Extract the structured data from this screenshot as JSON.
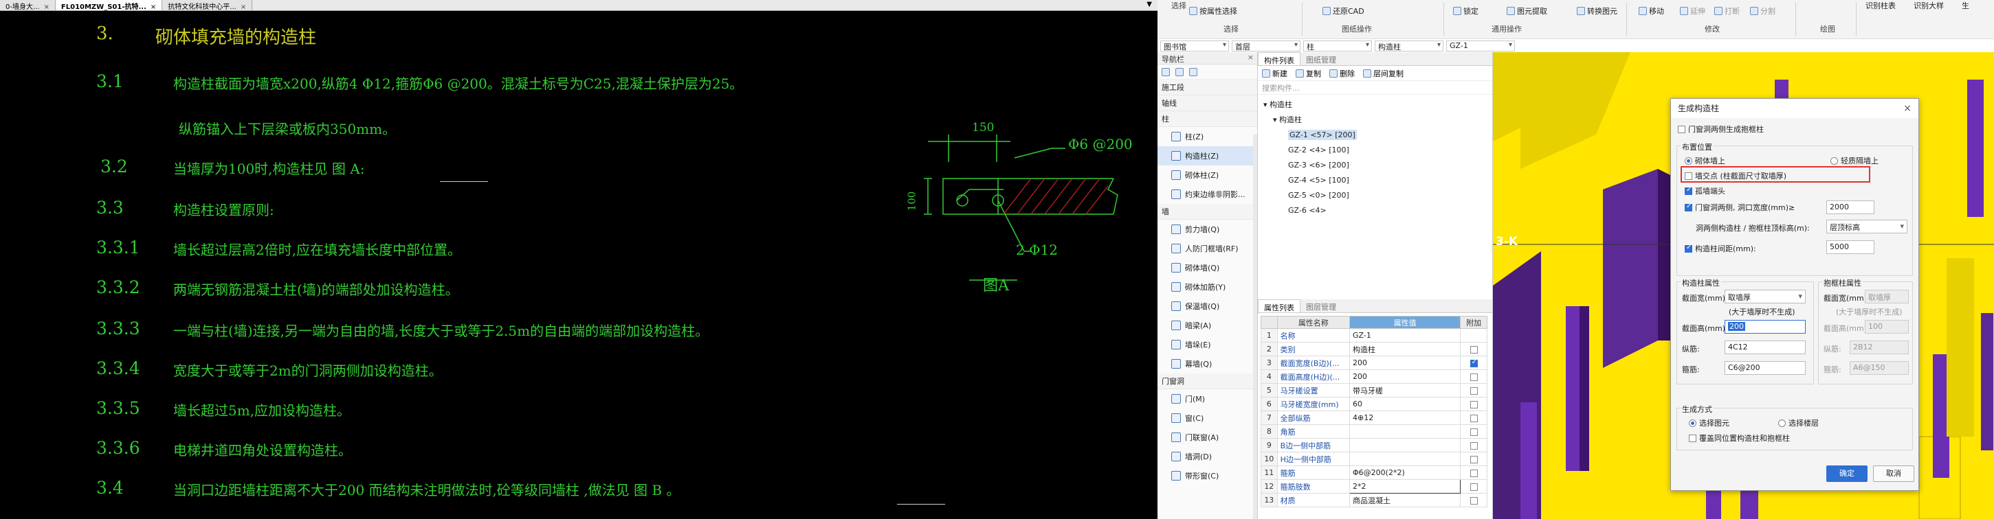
{
  "cad_tabs": [
    {
      "label": "0-墙身大...",
      "active": false
    },
    {
      "label": "FL010MZW_S01-抗特...",
      "active": true
    },
    {
      "label": "抗特文化科技中心平...",
      "active": false
    }
  ],
  "cad_text": {
    "h3": {
      "num": "3.",
      "title": "砌体填充墙的构造柱"
    },
    "items": [
      {
        "num": "3.1",
        "text": "构造柱截面为墙宽x200,纵筋4 Φ12,箍筋Φ6 @200。混凝土标号为C25,混凝土保护层为25。"
      },
      {
        "num": "",
        "text": "纵筋锚入上下层梁或板内350mm。"
      },
      {
        "num": "3.2",
        "text": "当墙厚为100时,构造柱见 图 A:"
      },
      {
        "num": "3.3",
        "text": "构造柱设置原则:"
      },
      {
        "num": "3.3.1",
        "text": "墙长超过层高2倍时,应在填充墙长度中部位置。"
      },
      {
        "num": "3.3.2",
        "text": "两端无钢筋混凝土柱(墙)的端部处加设构造柱。"
      },
      {
        "num": "3.3.3",
        "text": "一端与柱(墙)连接,另一端为自由的墙,长度大于或等于2.5m的自由端的端部加设构造柱。"
      },
      {
        "num": "3.3.4",
        "text": "宽度大于或等于2m的门洞两侧加设构造柱。"
      },
      {
        "num": "3.3.5",
        "text": "墙长超过5m,应加设构造柱。"
      },
      {
        "num": "3.3.6",
        "text": "电梯井道四角处设置构造柱。"
      },
      {
        "num": "3.4",
        "text": "当洞口边距墙柱距离不大于200 而结构未注明做法时,砼等级同墙柱 ,做法见 图 B 。"
      }
    ],
    "fig": {
      "dim150": "150",
      "dim100": "100",
      "stirrup": "Φ6 @200",
      "rebar": "2 Φ12",
      "caption": "图A"
    }
  },
  "ribbon": {
    "select_label": "选择",
    "pick_by_prop": "按属性选择",
    "restore_cad": "还原CAD",
    "lock": "锁定",
    "extract": "图元提取",
    "convert": "转换图元",
    "move": "移动",
    "rotate": "延伸",
    "trim": "打断",
    "split": "分割",
    "group_select": "选择",
    "group_cad": "图纸操作",
    "group_common": "通用操作",
    "group_modify": "修改",
    "group_draw": "绘图",
    "right1": "识别柱表",
    "right2": "识别大样",
    "right3": "生"
  },
  "filters": [
    "图书馆",
    "首层",
    "柱",
    "构造柱",
    "GZ-1"
  ],
  "nav": {
    "title": "导航栏",
    "rows": [
      {
        "type": "cat",
        "label": "施工段"
      },
      {
        "type": "cat",
        "label": "轴线"
      },
      {
        "type": "cat",
        "label": "柱"
      },
      {
        "type": "item",
        "label": "柱(Z)",
        "icon": "column-icon"
      },
      {
        "type": "item",
        "label": "构造柱(Z)",
        "icon": "constructional-column-icon",
        "selected": true
      },
      {
        "type": "item",
        "label": "砌体柱(Z)",
        "icon": "masonry-column-icon"
      },
      {
        "type": "item",
        "label": "约束边缘非阴影...",
        "icon": "edge-member-icon"
      },
      {
        "type": "cat",
        "label": "墙"
      },
      {
        "type": "item",
        "label": "剪力墙(Q)",
        "icon": "shear-wall-icon"
      },
      {
        "type": "item",
        "label": "人防门框墙(RF)",
        "icon": "door-frame-wall-icon"
      },
      {
        "type": "item",
        "label": "砌体墙(Q)",
        "icon": "masonry-wall-icon"
      },
      {
        "type": "item",
        "label": "砌体加筋(Y)",
        "icon": "masonry-rebar-icon"
      },
      {
        "type": "item",
        "label": "保温墙(Q)",
        "icon": "insulation-wall-icon"
      },
      {
        "type": "item",
        "label": "暗梁(A)",
        "icon": "hidden-beam-icon"
      },
      {
        "type": "item",
        "label": "墙垛(E)",
        "icon": "wall-buttress-icon"
      },
      {
        "type": "item",
        "label": "幕墙(Q)",
        "icon": "curtain-wall-icon"
      },
      {
        "type": "cat",
        "label": "门窗洞"
      },
      {
        "type": "item",
        "label": "门(M)",
        "icon": "door-icon"
      },
      {
        "type": "item",
        "label": "窗(C)",
        "icon": "window-icon"
      },
      {
        "type": "item",
        "label": "门联窗(A)",
        "icon": "door-window-icon"
      },
      {
        "type": "item",
        "label": "墙洞(D)",
        "icon": "wall-hole-icon"
      },
      {
        "type": "item",
        "label": "带形窗(C)",
        "icon": "strip-window-icon"
      }
    ]
  },
  "comp": {
    "tabs": [
      "构件列表",
      "图纸管理"
    ],
    "new": "新建",
    "copy": "复制",
    "delete": "删除",
    "layer_copy": "层间复制",
    "search_placeholder": "搜索构件...",
    "tree_root": "构造柱",
    "tree_sub": "构造柱",
    "items": [
      "GZ-1 <57> [200]",
      "GZ-2 <4> [100]",
      "GZ-3 <6> [200]",
      "GZ-4 <5> [100]",
      "GZ-5 <0> [200]",
      "GZ-6 <4>"
    ]
  },
  "props": {
    "tabs": [
      "属性列表",
      "图层管理"
    ],
    "headers": [
      "属性名称",
      "属性值",
      "附加"
    ],
    "rows": [
      {
        "n": "1",
        "k": "名称",
        "v": "GZ-1",
        "c": null
      },
      {
        "n": "2",
        "k": "类别",
        "v": "构造柱",
        "c": false
      },
      {
        "n": "3",
        "k": "截面宽度(B边)(...",
        "v": "200",
        "c": true
      },
      {
        "n": "4",
        "k": "截面高度(H边)(...",
        "v": "200",
        "c": false
      },
      {
        "n": "5",
        "k": "马牙槎设置",
        "v": "带马牙槎",
        "c": false
      },
      {
        "n": "6",
        "k": "马牙槎宽度(mm)",
        "v": "60",
        "c": false
      },
      {
        "n": "7",
        "k": "全部纵筋",
        "v": "4⊕12",
        "c": false
      },
      {
        "n": "8",
        "k": "角筋",
        "v": "",
        "c": false
      },
      {
        "n": "9",
        "k": "B边一侧中部筋",
        "v": "",
        "c": false
      },
      {
        "n": "10",
        "k": "H边一侧中部筋",
        "v": "",
        "c": false
      },
      {
        "n": "11",
        "k": "箍筋",
        "v": "Φ6@200(2*2)",
        "c": false
      },
      {
        "n": "12",
        "k": "箍筋肢数",
        "v": "2*2",
        "c": false
      },
      {
        "n": "13",
        "k": "材质",
        "v": "商品混凝土",
        "c": false
      }
    ]
  },
  "view": {
    "axis_label": "3-K"
  },
  "dialog": {
    "title": "生成构造柱",
    "gate_wall": "门窗洞两侧生成抱框柱",
    "position_group": "布置位置",
    "opt_on_wall": "砌体墙上",
    "opt_light_wall": "轻质隔墙上",
    "cross_point": "墙交点 (柱截面尺寸取墙厚)",
    "isolated_end": "孤墙端头",
    "door_sides": "门窗洞两侧, 洞口宽度(mm)≥",
    "door_width": "2000",
    "top_label": "洞两侧构造柱 / 抱框柱顶标高(m):",
    "top_value": "层顶标高",
    "spacing": "构造柱间距(mm):",
    "spacing_value": "5000",
    "gz_prop": "构造柱属性",
    "bk_prop": "抱框柱属性",
    "width_label": "截面宽(mm):",
    "width_value": "取墙厚",
    "width_hint": "(大于墙厚时不生成)",
    "height_label": "截面高(mm):",
    "height_value": "200",
    "long_label": "纵筋:",
    "long_value": "4C12",
    "stir_label": "箍筋:",
    "stir_value": "C6@200",
    "bk_width_value": "取墙厚",
    "bk_hint": "(大于墙厚时不生成)",
    "bk_height_value": "100",
    "bk_long_value": "2B12",
    "bk_stir_value": "A6@150",
    "gen_mode": "生成方式",
    "mode_pick": "选择图元",
    "mode_floor": "选择楼层",
    "override": "覆盖同位置构造柱和抱框柱",
    "ok": "确定",
    "cancel": "取消"
  }
}
